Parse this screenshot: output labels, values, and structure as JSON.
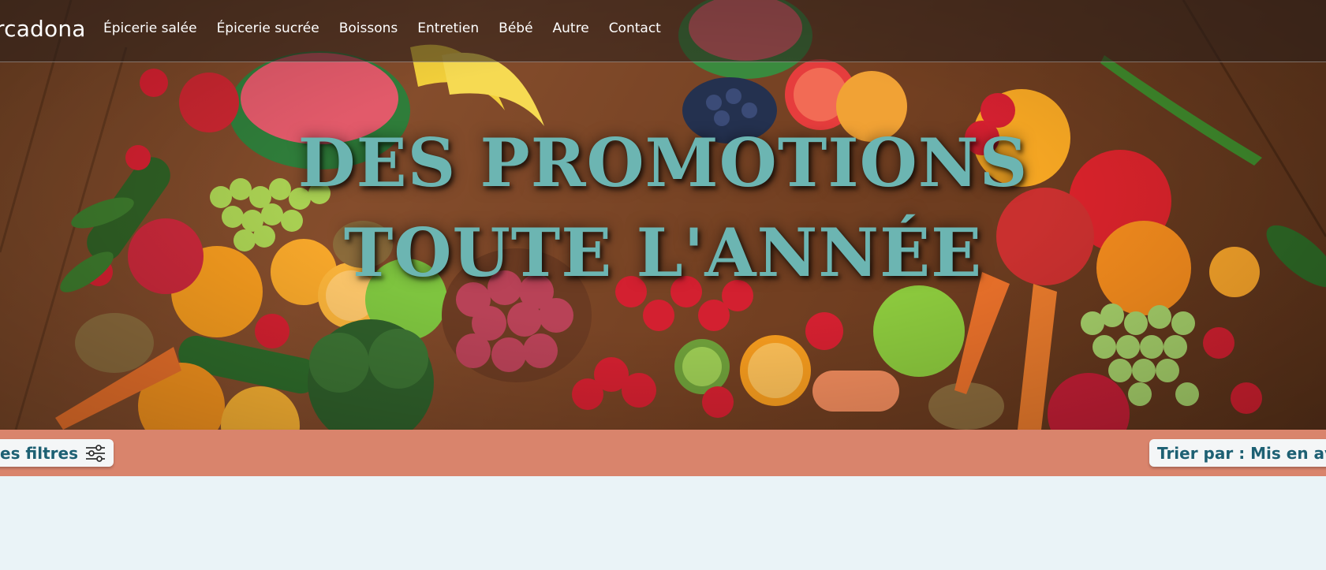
{
  "brand": {
    "name": "rcadona"
  },
  "nav": {
    "items": [
      {
        "label": "Épicerie salée"
      },
      {
        "label": "Épicerie sucrée"
      },
      {
        "label": "Boissons"
      },
      {
        "label": "Entretien"
      },
      {
        "label": "Bébé"
      },
      {
        "label": "Autre"
      },
      {
        "label": "Contact"
      }
    ]
  },
  "hero": {
    "title_line1": "DES PROMOTIONS",
    "title_line2": "TOUTE L'ANNÉE",
    "image_icon": "fruits-and-vegetables-illustration"
  },
  "filterbar": {
    "filters_label": "es filtres",
    "filters_icon": "sliders-icon",
    "sort_label": "Trier par : Mis en ava"
  },
  "colors": {
    "accent_teal": "#6cb5b2",
    "button_text": "#1d6073",
    "filterbar_bg": "#d9846c",
    "page_bg": "#eaf3f7"
  }
}
